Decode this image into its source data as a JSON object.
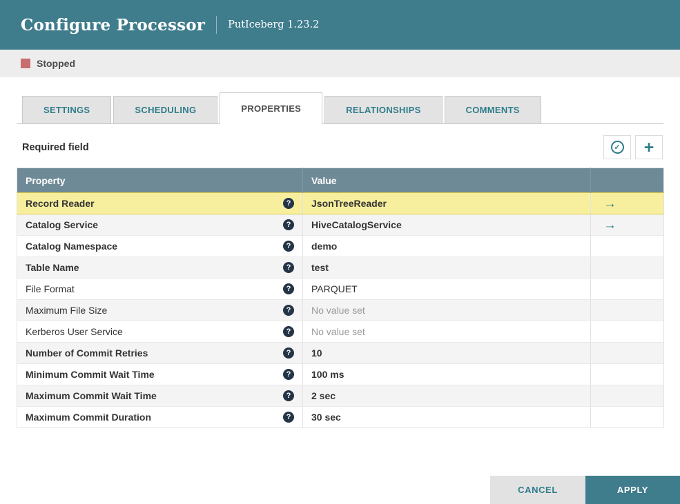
{
  "header": {
    "title": "Configure Processor",
    "subtitle": "PutIceberg 1.23.2"
  },
  "status": {
    "label": "Stopped"
  },
  "tabs": [
    {
      "label": "SETTINGS",
      "active": false
    },
    {
      "label": "SCHEDULING",
      "active": false
    },
    {
      "label": "PROPERTIES",
      "active": true
    },
    {
      "label": "RELATIONSHIPS",
      "active": false
    },
    {
      "label": "COMMENTS",
      "active": false
    }
  ],
  "toolbar": {
    "required_field_label": "Required field"
  },
  "icons": {
    "verify_check_glyph": "✓",
    "plus_glyph": "+",
    "help_glyph": "?",
    "arrow_glyph": "→"
  },
  "table": {
    "columns": [
      "Property",
      "Value"
    ],
    "rows": [
      {
        "property": "Record Reader",
        "value": "JsonTreeReader",
        "required": true,
        "empty": false,
        "has_arrow": true,
        "selected": true
      },
      {
        "property": "Catalog Service",
        "value": "HiveCatalogService",
        "required": true,
        "empty": false,
        "has_arrow": true,
        "selected": false
      },
      {
        "property": "Catalog Namespace",
        "value": "demo",
        "required": true,
        "empty": false,
        "has_arrow": false,
        "selected": false
      },
      {
        "property": "Table Name",
        "value": "test",
        "required": true,
        "empty": false,
        "has_arrow": false,
        "selected": false
      },
      {
        "property": "File Format",
        "value": "PARQUET",
        "required": false,
        "empty": false,
        "has_arrow": false,
        "selected": false
      },
      {
        "property": "Maximum File Size",
        "value": "No value set",
        "required": false,
        "empty": true,
        "has_arrow": false,
        "selected": false
      },
      {
        "property": "Kerberos User Service",
        "value": "No value set",
        "required": false,
        "empty": true,
        "has_arrow": false,
        "selected": false
      },
      {
        "property": "Number of Commit Retries",
        "value": "10",
        "required": true,
        "empty": false,
        "has_arrow": false,
        "selected": false
      },
      {
        "property": "Minimum Commit Wait Time",
        "value": "100 ms",
        "required": true,
        "empty": false,
        "has_arrow": false,
        "selected": false
      },
      {
        "property": "Maximum Commit Wait Time",
        "value": "2 sec",
        "required": true,
        "empty": false,
        "has_arrow": false,
        "selected": false
      },
      {
        "property": "Maximum Commit Duration",
        "value": "30 sec",
        "required": true,
        "empty": false,
        "has_arrow": false,
        "selected": false
      }
    ]
  },
  "footer": {
    "cancel_label": "CANCEL",
    "apply_label": "APPLY"
  },
  "colors": {
    "header_bg": "#3f7c8c",
    "accent_teal": "#2f7d8a",
    "table_header_bg": "#6f8a97",
    "selected_row_bg": "#f7ef9d",
    "selected_row_border": "#ddc94e",
    "stopped_color": "#c86e6e",
    "row_alt_bg": "#f4f4f4"
  }
}
